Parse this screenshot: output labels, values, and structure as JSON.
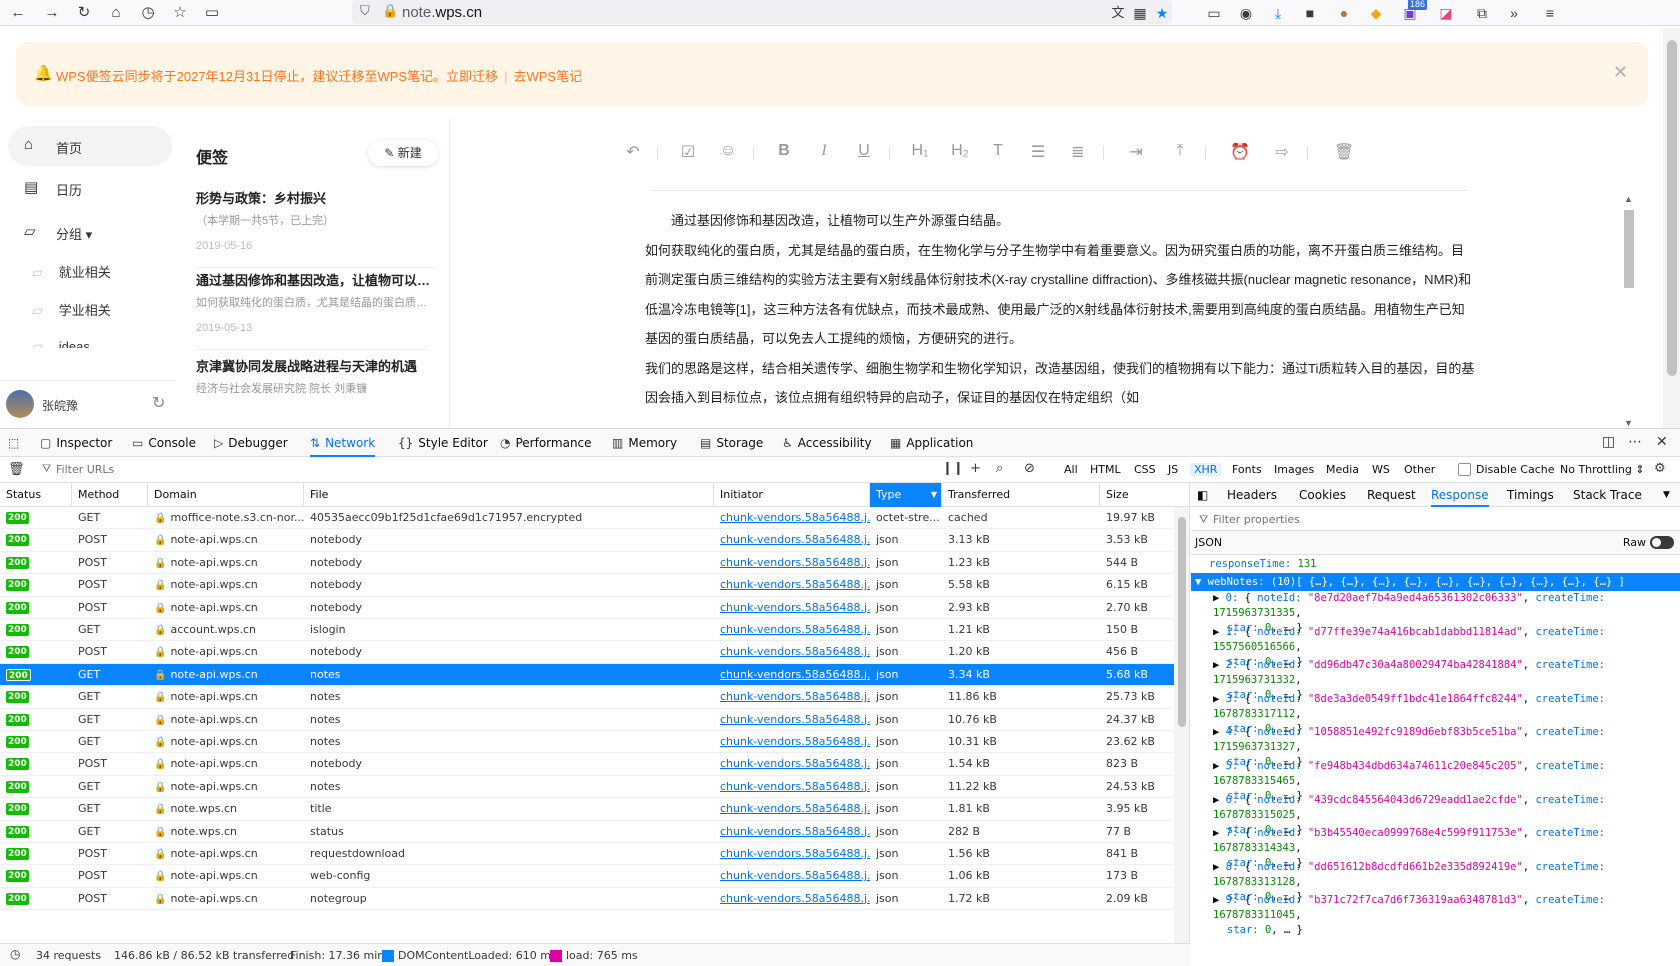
{
  "browser": {
    "url_host": "note.wps.cn",
    "url_domain_main": "note.",
    "url_domain_rest": "wps.cn",
    "ext_badge": "186"
  },
  "banner": {
    "text": "WPS便签云同步将于2027年12月31日停止，建议迁移至WPS笔记。",
    "link_migrate": "立即迁移",
    "separator": "|",
    "link_go": "去WPS笔记"
  },
  "sidebar": {
    "items": [
      {
        "label": "首页",
        "icon": "home-icon"
      },
      {
        "label": "日历",
        "icon": "calendar-icon"
      },
      {
        "label": "分组 ▾",
        "icon": "folder-icon"
      }
    ],
    "sub_items": [
      "就业相关",
      "学业相关",
      "ideas"
    ],
    "user": {
      "name": "张皖豫"
    }
  },
  "notelist": {
    "title": "便签",
    "new_button": "新建",
    "notes": [
      {
        "title": "形势与政策：乡村振兴",
        "snippet": "（本学期一共5节，已上完）",
        "date": "2019-05-16"
      },
      {
        "title": "通过基因修饰和基因改造，让植物可以生产外源蛋白结晶。",
        "snippet": "如何获取纯化的蛋白质，尤其是结晶的蛋白质，在生物化学与分子生物学中有着重要意义。",
        "date": "2019-05-13"
      },
      {
        "title": "京津冀协同发展战略进程与天津的机遇",
        "snippet": "经济与社会发展研究院 院长 刘秉镰",
        "date": ""
      }
    ]
  },
  "editor": {
    "paragraphs": [
      "　　通过基因修饰和基因改造，让植物可以生产外源蛋白结晶。",
      "如何获取纯化的蛋白质，尤其是结晶的蛋白质，在生物化学与分子生物学中有着重要意义。因为研究蛋白质的功能，离不开蛋白质三维结构。目前测定蛋白质三维结构的实验方法主要有X射线晶体衍射技术(X-ray crystalline diffraction)、多维核磁共振(nuclear magnetic resonance，NMR)和低温冷冻电镜等[1]，这三种方法各有优缺点，而技术最成熟、使用最广泛的X射线晶体衍射技术,需要用到高纯度的蛋白质结晶。用植物生产已知基因的蛋白质结晶，可以免去人工提纯的烦恼，方便研究的进行。",
      "我们的思路是这样，结合相关遗传学、细胞生物学和生物化学知识，改造基因组，使我们的植物拥有以下能力：通过Ti质粒转入目的基因，目的基因会插入到目标位点，该位点拥有组织特异的启动子，保证目的基因仅在特定组织（如"
    ]
  },
  "devtools": {
    "tabs": [
      "Inspector",
      "Console",
      "Debugger",
      "Network",
      "Style Editor",
      "Performance",
      "Memory",
      "Storage",
      "Accessibility",
      "Application"
    ],
    "active_tab": "Network",
    "filter_placeholder": "Filter URLs",
    "type_filters": [
      "All",
      "HTML",
      "CSS",
      "JS",
      "XHR",
      "Fonts",
      "Images",
      "Media",
      "WS",
      "Other"
    ],
    "active_type": "XHR",
    "disable_cache": "Disable Cache",
    "throttling": "No Throttling ⇕",
    "columns": [
      "Status",
      "Method",
      "Domain",
      "File",
      "Initiator",
      "Type",
      "Transferred",
      "Size"
    ],
    "requests": [
      {
        "status": "200",
        "method": "GET",
        "domain": "moffice-note.s3.cn-nor...",
        "file": "40535aecc09b1f25d1cfae69d1c71957.encrypted",
        "initiator": "chunk-vendors.58a56488.j...",
        "type": "octet-stre...",
        "transferred": "cached",
        "size": "19.97 kB"
      },
      {
        "status": "200",
        "method": "POST",
        "domain": "note-api.wps.cn",
        "file": "notebody",
        "initiator": "chunk-vendors.58a56488.j...",
        "type": "json",
        "transferred": "3.13 kB",
        "size": "3.53 kB"
      },
      {
        "status": "200",
        "method": "POST",
        "domain": "note-api.wps.cn",
        "file": "notebody",
        "initiator": "chunk-vendors.58a56488.j...",
        "type": "json",
        "transferred": "1.23 kB",
        "size": "544 B"
      },
      {
        "status": "200",
        "method": "POST",
        "domain": "note-api.wps.cn",
        "file": "notebody",
        "initiator": "chunk-vendors.58a56488.j...",
        "type": "json",
        "transferred": "5.58 kB",
        "size": "6.15 kB"
      },
      {
        "status": "200",
        "method": "POST",
        "domain": "note-api.wps.cn",
        "file": "notebody",
        "initiator": "chunk-vendors.58a56488.j...",
        "type": "json",
        "transferred": "2.93 kB",
        "size": "2.70 kB"
      },
      {
        "status": "200",
        "method": "GET",
        "domain": "account.wps.cn",
        "file": "islogin",
        "initiator": "chunk-vendors.58a56488.j...",
        "type": "json",
        "transferred": "1.21 kB",
        "size": "150 B"
      },
      {
        "status": "200",
        "method": "POST",
        "domain": "note-api.wps.cn",
        "file": "notebody",
        "initiator": "chunk-vendors.58a56488.j...",
        "type": "json",
        "transferred": "1.20 kB",
        "size": "456 B"
      },
      {
        "status": "200",
        "method": "GET",
        "domain": "note-api.wps.cn",
        "file": "notes",
        "initiator": "chunk-vendors.58a56488.j...",
        "type": "json",
        "transferred": "3.34 kB",
        "size": "5.68 kB"
      },
      {
        "status": "200",
        "method": "GET",
        "domain": "note-api.wps.cn",
        "file": "notes",
        "initiator": "chunk-vendors.58a56488.j...",
        "type": "json",
        "transferred": "11.86 kB",
        "size": "25.73 kB"
      },
      {
        "status": "200",
        "method": "GET",
        "domain": "note-api.wps.cn",
        "file": "notes",
        "initiator": "chunk-vendors.58a56488.j...",
        "type": "json",
        "transferred": "10.76 kB",
        "size": "24.37 kB"
      },
      {
        "status": "200",
        "method": "GET",
        "domain": "note-api.wps.cn",
        "file": "notes",
        "initiator": "chunk-vendors.58a56488.j...",
        "type": "json",
        "transferred": "10.31 kB",
        "size": "23.62 kB"
      },
      {
        "status": "200",
        "method": "POST",
        "domain": "note-api.wps.cn",
        "file": "notebody",
        "initiator": "chunk-vendors.58a56488.j...",
        "type": "json",
        "transferred": "1.54 kB",
        "size": "823 B"
      },
      {
        "status": "200",
        "method": "GET",
        "domain": "note-api.wps.cn",
        "file": "notes",
        "initiator": "chunk-vendors.58a56488.j...",
        "type": "json",
        "transferred": "11.22 kB",
        "size": "24.53 kB"
      },
      {
        "status": "200",
        "method": "GET",
        "domain": "note.wps.cn",
        "file": "title",
        "initiator": "chunk-vendors.58a56488.j...",
        "type": "json",
        "transferred": "1.81 kB",
        "size": "3.95 kB"
      },
      {
        "status": "200",
        "method": "GET",
        "domain": "note.wps.cn",
        "file": "status",
        "initiator": "chunk-vendors.58a56488.j...",
        "type": "json",
        "transferred": "282 B",
        "size": "77 B"
      },
      {
        "status": "200",
        "method": "POST",
        "domain": "note-api.wps.cn",
        "file": "requestdownload",
        "initiator": "chunk-vendors.58a56488.j...",
        "type": "json",
        "transferred": "1.56 kB",
        "size": "841 B"
      },
      {
        "status": "200",
        "method": "POST",
        "domain": "note-api.wps.cn",
        "file": "web-config",
        "initiator": "chunk-vendors.58a56488.j...",
        "type": "json",
        "transferred": "1.06 kB",
        "size": "173 B"
      },
      {
        "status": "200",
        "method": "POST",
        "domain": "note-api.wps.cn",
        "file": "notegroup",
        "initiator": "chunk-vendors.58a56488.j...",
        "type": "json",
        "transferred": "1.72 kB",
        "size": "2.09 kB"
      }
    ],
    "selected_request_index": 7,
    "status_bar": {
      "requests": "34 requests",
      "transferred": "146.86 kB / 86.52 kB transferred",
      "finish": "Finish: 17.36 min",
      "dcl": "DOMContentLoaded: 610 ms",
      "load": "load: 765 ms",
      "dcl_color": "#0a84ff",
      "load_color": "#dd00a9"
    },
    "response_tabs": [
      "Headers",
      "Cookies",
      "Request",
      "Response",
      "Timings",
      "Stack Trace"
    ],
    "active_response_tab": "Response",
    "filter_properties": "Filter properties",
    "json_label": "JSON",
    "raw_label": "Raw",
    "json": {
      "responseTime_key": "responseTime:",
      "responseTime_val": "131",
      "webNotes_line": "webNotes: (10)[ {…}, {…}, {…}, {…}, {…}, {…}, {…}, {…}, {…}, {…} ]",
      "items": [
        {
          "idx": "0:",
          "noteId": "\"8e7d20aef7b4a9ed4a65361302c06333\"",
          "createTime": "1715963731335"
        },
        {
          "idx": "1:",
          "noteId": "\"d77ffe39e74a416bcab1dabbd11814ad\"",
          "createTime": "1557560516566"
        },
        {
          "idx": "2:",
          "noteId": "\"dd96db47c30a4a80029474ba42841884\"",
          "createTime": "1715963731332"
        },
        {
          "idx": "3:",
          "noteId": "\"8de3a3de0549ff1bdc41e1864ffc8244\"",
          "createTime": "1678783317112"
        },
        {
          "idx": "4:",
          "noteId": "\"1058851e492fc9189d6ebf83b5ce51ba\"",
          "createTime": "1715963731327"
        },
        {
          "idx": "5:",
          "noteId": "\"fe948b434dbd634a74611c20e845c205\"",
          "createTime": "1678783315465"
        },
        {
          "idx": "6:",
          "noteId": "\"439cdc845564043d6729eadd1ae2cfde\"",
          "createTime": "1678783315025"
        },
        {
          "idx": "7:",
          "noteId": "\"b3b45540eca0999768e4c599f911753e\"",
          "createTime": "1678783314343"
        },
        {
          "idx": "8:",
          "noteId": "\"dd651612b8dcdfd661b2e335d892419e\"",
          "createTime": "1678783313128"
        },
        {
          "idx": "9:",
          "noteId": "\"b371c72f7ca7d6f736319aa6348781d3\"",
          "createTime": "1678783311045"
        }
      ]
    }
  }
}
